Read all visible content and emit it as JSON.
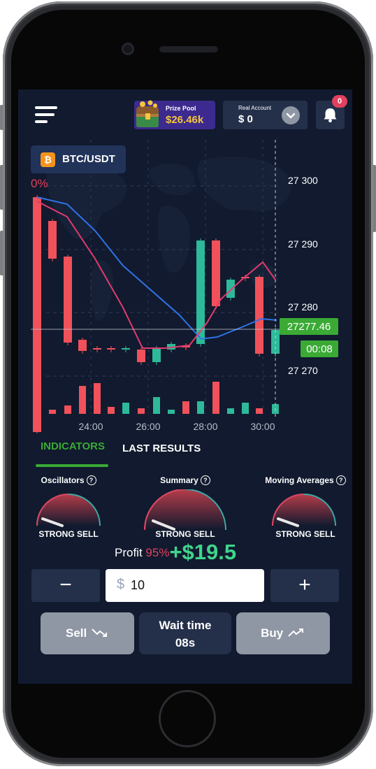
{
  "header": {
    "prize_pool_label": "Prize Pool",
    "prize_pool_value": "$26.46k",
    "account_label": "Real Account",
    "account_value": "$ 0",
    "notification_count": "0"
  },
  "asset": {
    "pair": "BTC/USDT",
    "change": "0%"
  },
  "chart_data": {
    "type": "candlestick",
    "y_ticks": [
      "27 300",
      "27 290",
      "27 280",
      "27 270"
    ],
    "x_ticks": [
      "24:00",
      "26:00",
      "28:00",
      "30:00"
    ],
    "current_price": "27277.46",
    "countdown": "00:08",
    "colors": {
      "up": "#2eb99a",
      "down": "#f0515a",
      "ma_fast": "#2f72e8",
      "ma_slow": "#e23a6f",
      "price_badge": "#3aaa35"
    }
  },
  "tabs": [
    {
      "label": "INDICATORS",
      "active": true
    },
    {
      "label": "LAST RESULTS",
      "active": false
    }
  ],
  "gauges": [
    {
      "title": "Oscillators",
      "value": "STRONG SELL"
    },
    {
      "title": "Summary",
      "value": "STRONG SELL"
    },
    {
      "title": "Moving Averages",
      "value": "STRONG SELL"
    }
  ],
  "trade": {
    "profit_label": "Profit",
    "profit_percent": "95%",
    "profit_value": "+$19.5",
    "currency_symbol": "$",
    "amount": "10",
    "minus": "−",
    "plus": "+",
    "sell_label": "Sell",
    "buy_label": "Buy",
    "wait_label": "Wait time",
    "wait_value": "08s"
  }
}
